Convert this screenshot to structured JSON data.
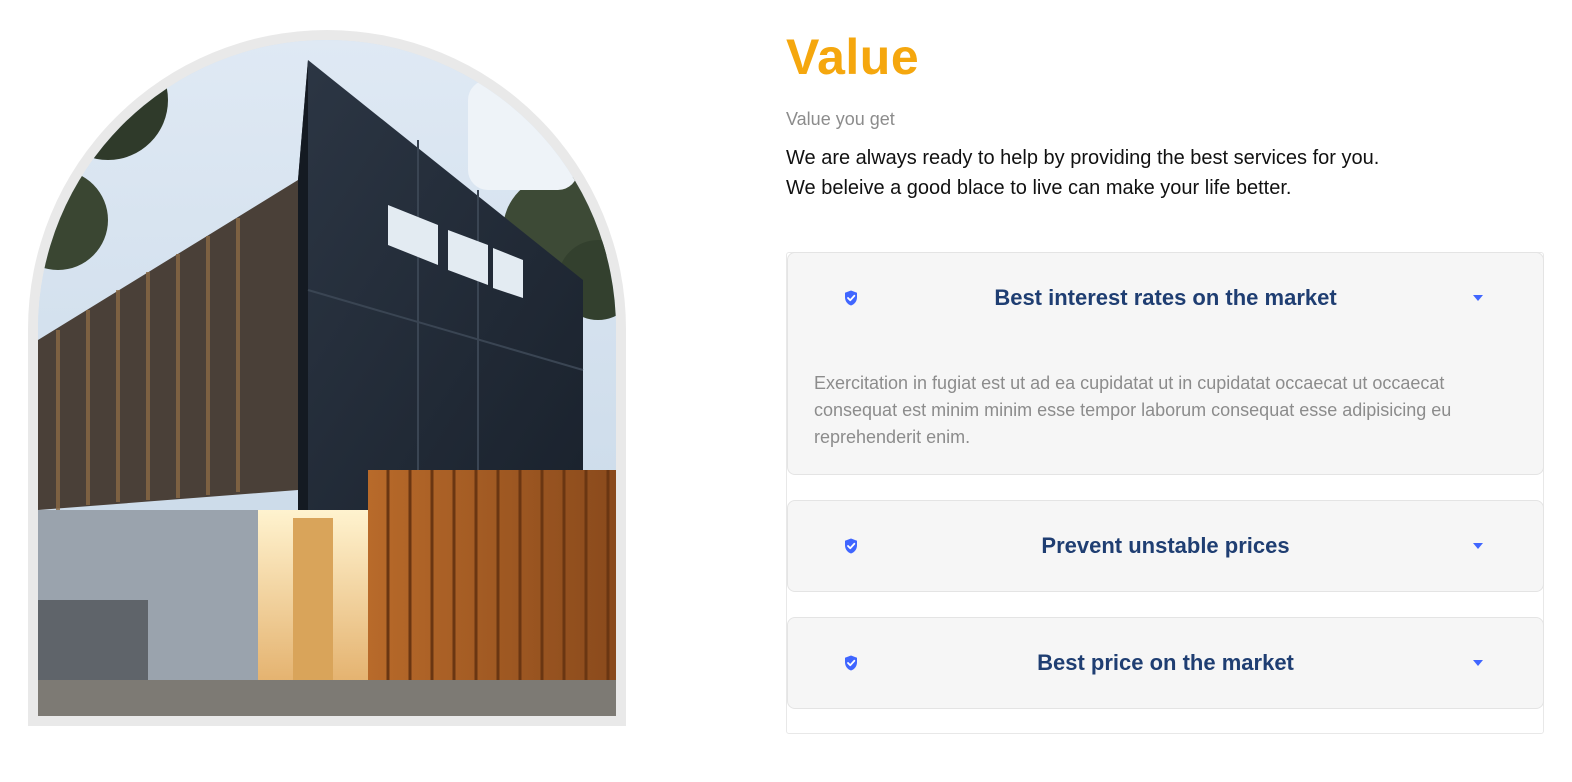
{
  "image": {
    "alt": "Modern two-storey house with dark metal cladding and timber slats"
  },
  "section": {
    "title": "Value",
    "subtitle": "Value you get",
    "description_line1": "We are always ready to help by providing the best services for you.",
    "description_line2": "We beleive a good blace to live can make your life better."
  },
  "accordion": {
    "items": [
      {
        "icon": "shield-check-icon",
        "heading": "Best interest rates on the market",
        "expanded": true,
        "body": "Exercitation in fugiat est ut ad ea cupidatat ut in cupidatat occaecat ut occaecat consequat est minim minim esse tempor laborum consequat esse adipisicing eu reprehenderit enim."
      },
      {
        "icon": "shield-check-icon",
        "heading": "Prevent unstable prices",
        "expanded": false
      },
      {
        "icon": "shield-check-icon",
        "heading": "Best price on the market",
        "expanded": false
      }
    ]
  },
  "colors": {
    "title": "#f5a70e",
    "heading": "#1f3e72",
    "icon": "#4066ff",
    "muted": "#8c8c8c",
    "panel": "#f6f6f6"
  }
}
